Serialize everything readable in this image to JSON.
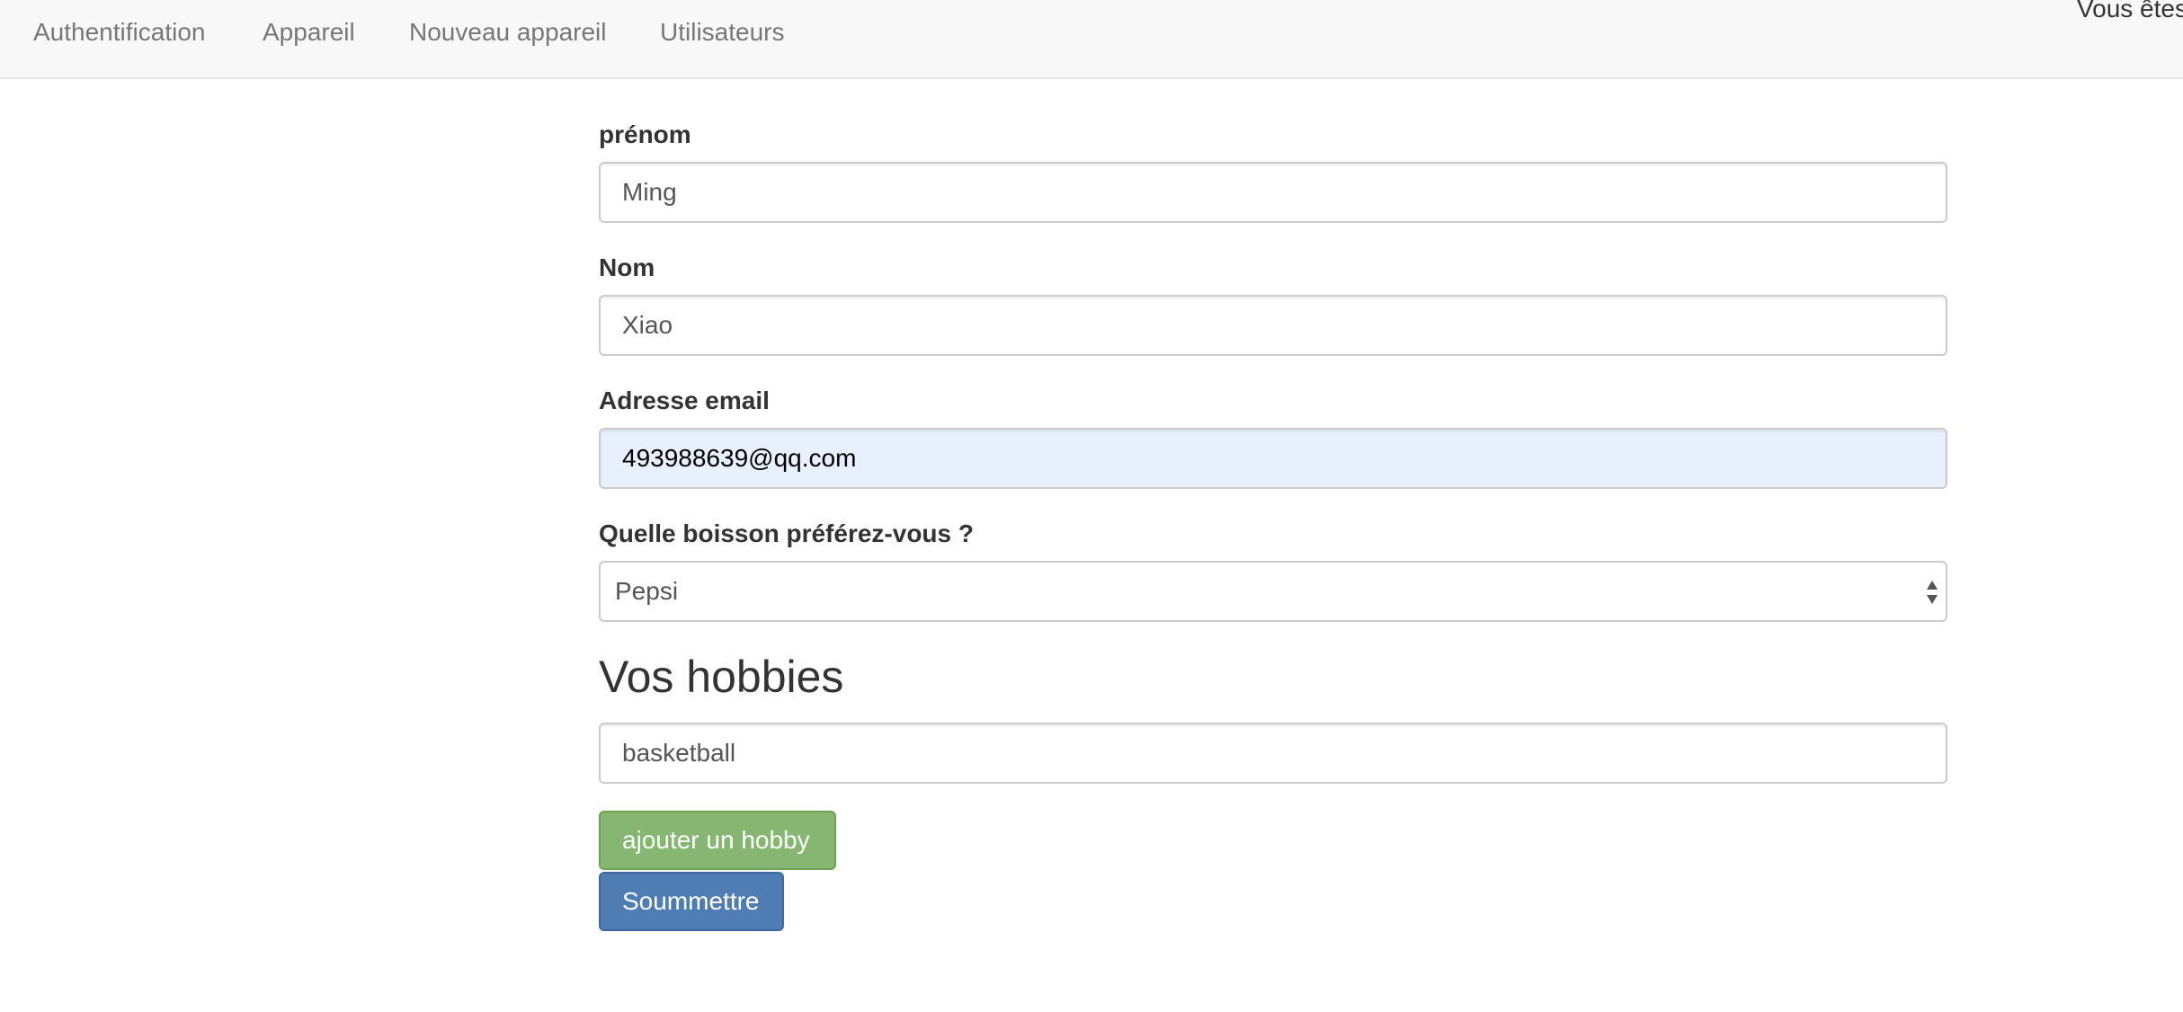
{
  "navbar": {
    "links": [
      {
        "label": "Authentification"
      },
      {
        "label": "Appareil"
      },
      {
        "label": "Nouveau appareil"
      },
      {
        "label": "Utilisateurs"
      }
    ],
    "right_text": "Vous êtes"
  },
  "form": {
    "firstname": {
      "label": "prénom",
      "value": "Ming"
    },
    "lastname": {
      "label": "Nom",
      "value": "Xiao"
    },
    "email": {
      "label": "Adresse email",
      "value": "493988639@qq.com"
    },
    "drink": {
      "label": "Quelle boisson préférez-vous ?",
      "selected": "Pepsi"
    },
    "hobbies_title": "Vos hobbies",
    "hobbies": [
      {
        "value": "basketball"
      }
    ],
    "add_hobby_label": "ajouter un hobby",
    "submit_label": "Soummettre"
  },
  "colors": {
    "navbar_bg": "#f8f8f8",
    "autofill_bg": "#e8f0fe",
    "success_button": "#86b672",
    "primary_button": "#4f7db3"
  }
}
